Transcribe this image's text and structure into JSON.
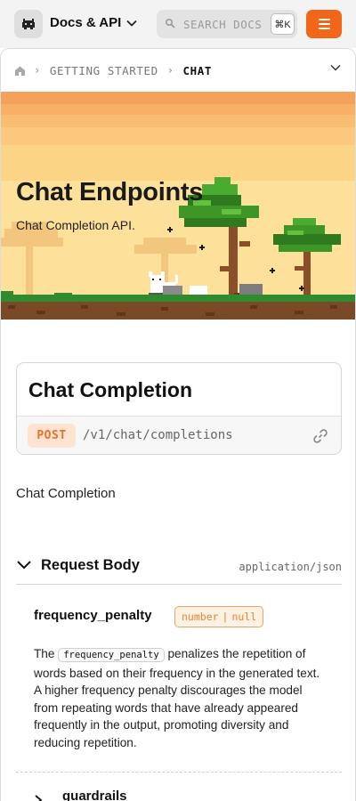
{
  "header": {
    "brand": "Docs & API",
    "search_placeholder": "SEARCH DOCS",
    "search_shortcut": "⌘K"
  },
  "breadcrumb": {
    "items": [
      "GETTING STARTED",
      "CHAT"
    ]
  },
  "hero": {
    "title": "Chat Endpoints",
    "subtitle": "Chat Completion API."
  },
  "endpoint": {
    "title": "Chat Completion",
    "method": "POST",
    "path": "/v1/chat/completions"
  },
  "description": "Chat Completion",
  "request_body": {
    "title": "Request Body",
    "content_type": "application/json",
    "params": [
      {
        "name": "frequency_penalty",
        "types": [
          "number",
          "null"
        ],
        "desc_prefix": "The",
        "desc_code": "frequency_penalty",
        "desc_rest": "penalizes the repetition of words based on their frequency in the generated text. A higher frequency penalty discourages the model from repeating words that have already appeared frequently in the output, promoting diversity and reducing repetition."
      },
      {
        "name": "guardrails"
      }
    ]
  },
  "colors": {
    "accent": "#f2661a",
    "method_bg": "#fde3d1",
    "method_text": "#e8722a",
    "hero_sky_top": "#f6a15c",
    "hero_sky_bottom": "#fde6a0",
    "grass": "#2e8b2e",
    "dirt": "#7a4a26"
  },
  "icons": {
    "logo": "pixel-cat-icon",
    "brand_dropdown": "chevron-down-icon",
    "search": "search-icon",
    "menu": "hamburger-menu-icon",
    "home": "home-icon",
    "breadcrumb_toggle": "chevron-down-icon",
    "link": "link-icon",
    "request_body_toggle": "chevron-down-icon",
    "guardrails_toggle": "chevron-right-icon"
  }
}
